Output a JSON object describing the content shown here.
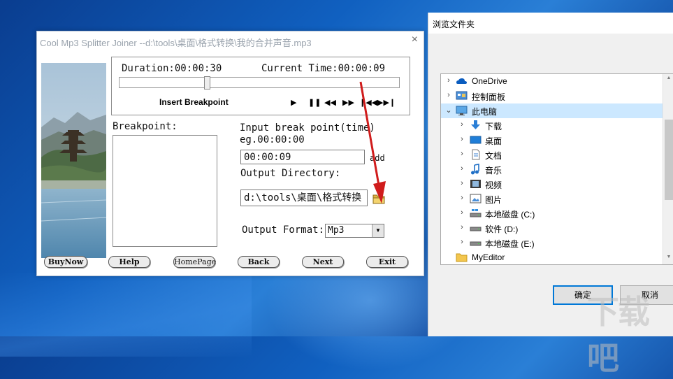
{
  "app": {
    "title": "Cool Mp3 Splitter Joiner --d:\\tools\\桌面\\格式转换\\我的合并声音.mp3",
    "close_glyph": "×",
    "duration_label": "Duration:00:00:30",
    "current_time_label": "Current Time:00:00:09",
    "insert_breakpoint": "Insert Breakpoint",
    "controls": [
      "play-icon",
      "pause-icon",
      "rewind-icon",
      "fast-forward-icon",
      "skip-start-icon",
      "skip-end-icon"
    ],
    "control_glyphs": [
      "▶",
      "❚❚",
      "◀◀",
      "▶▶",
      "❙◀◀",
      "▶▶❙"
    ],
    "progress": 0.31,
    "breakpoint_label": "Breakpoint:",
    "input_break_label_1": "Input break point(time)",
    "input_break_label_2": "eg.00:00:00",
    "input_break_value": "00:00:09",
    "add_label": "add",
    "output_directory_label": "Output Directory:",
    "output_directory_value": "d:\\tools\\桌面\\格式转换",
    "output_format_label": "Output Format:",
    "output_format_value": "Mp3",
    "buttons": {
      "buynow": "BuyNow",
      "help": "Help",
      "homepage": "HomePage",
      "back": "Back",
      "next": "Next",
      "exit": "Exit"
    }
  },
  "dialog": {
    "title": "浏览文件夹",
    "tree": [
      {
        "label": "OneDrive",
        "icon": "cloud-icon"
      },
      {
        "label": "控制面板",
        "icon": "control-panel-icon"
      },
      {
        "label": "此电脑",
        "icon": "computer-icon",
        "expanded": true,
        "selected": true
      },
      {
        "label": "下载",
        "icon": "download-icon"
      },
      {
        "label": "桌面",
        "icon": "desktop-icon"
      },
      {
        "label": "文档",
        "icon": "document-icon"
      },
      {
        "label": "音乐",
        "icon": "music-icon"
      },
      {
        "label": "视频",
        "icon": "video-icon"
      },
      {
        "label": "图片",
        "icon": "picture-icon"
      },
      {
        "label": "本地磁盘 (C:)",
        "icon": "drive-icon"
      },
      {
        "label": "软件 (D:)",
        "icon": "drive-icon"
      },
      {
        "label": "本地磁盘 (E:)",
        "icon": "drive-icon"
      },
      {
        "label": "MyEditor",
        "icon": "folder-icon"
      }
    ],
    "ok_label": "确定",
    "cancel_label": "取消"
  },
  "colors": {
    "selection": "#cce8ff",
    "accent": "#0078d7",
    "arrow": "#d01c1c"
  },
  "watermark": "下载吧"
}
